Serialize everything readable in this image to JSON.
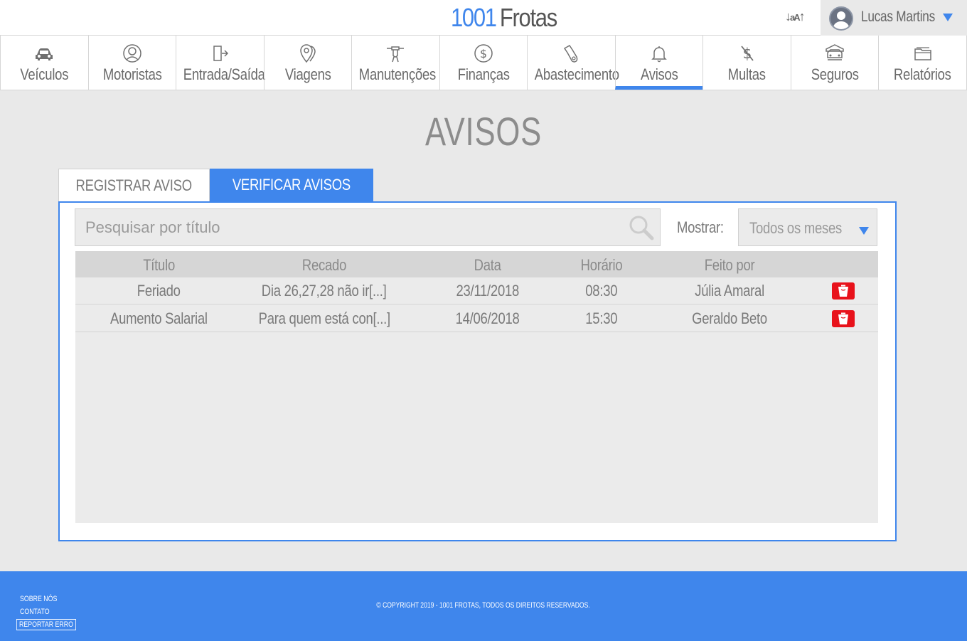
{
  "app": {
    "brand_number": "1001",
    "brand_word": "Frotas"
  },
  "header": {
    "font_size_control": "aA",
    "user_name": "Lucas Martins"
  },
  "nav": {
    "items": [
      {
        "label": "Veículos",
        "icon": "car-icon"
      },
      {
        "label": "Motoristas",
        "icon": "driver-icon"
      },
      {
        "label": "Entrada/Saída",
        "icon": "door-exit-icon"
      },
      {
        "label": "Viagens",
        "icon": "map-pin-icon"
      },
      {
        "label": "Manutenções",
        "icon": "wrench-icon"
      },
      {
        "label": "Finanças",
        "icon": "dollar-icon"
      },
      {
        "label": "Abastecimento",
        "icon": "fuel-nozzle-icon"
      },
      {
        "label": "Avisos",
        "icon": "bell-icon",
        "active": true
      },
      {
        "label": "Multas",
        "icon": "no-money-icon"
      },
      {
        "label": "Seguros",
        "icon": "insurance-icon"
      },
      {
        "label": "Relatórios",
        "icon": "folder-icon"
      }
    ]
  },
  "main": {
    "title": "AVISOS",
    "tabs": [
      {
        "label": "REGISTRAR AVISO"
      },
      {
        "label": "VERIFICAR AVISOS",
        "active": true
      }
    ],
    "search": {
      "placeholder": "Pesquisar por título",
      "value": ""
    },
    "filter": {
      "label": "Mostrar:",
      "selected": "Todos os meses"
    },
    "table": {
      "headers": [
        "Título",
        "Recado",
        "Data",
        "Horário",
        "Feito por"
      ],
      "rows": [
        [
          "Feriado",
          "Dia 26,27,28 não ir[...]",
          "23/11/2018",
          "08:30",
          "Júlia Amaral"
        ],
        [
          "Aumento Salarial",
          "Para quem está con[...]",
          "14/06/2018",
          "15:30",
          "Geraldo Beto"
        ]
      ]
    }
  },
  "footer": {
    "about": "SOBRE NÓS",
    "contact": "CONTATO",
    "report": "REPORTAR ERRO",
    "copyright": "© COPYRIGHT 2019 - 1001 FROTAS, TODOS OS DIREITOS RESERVADOS."
  },
  "colors": {
    "accent": "#3f86ec",
    "delete": "#e8121b",
    "background": "#e9e9e9"
  }
}
